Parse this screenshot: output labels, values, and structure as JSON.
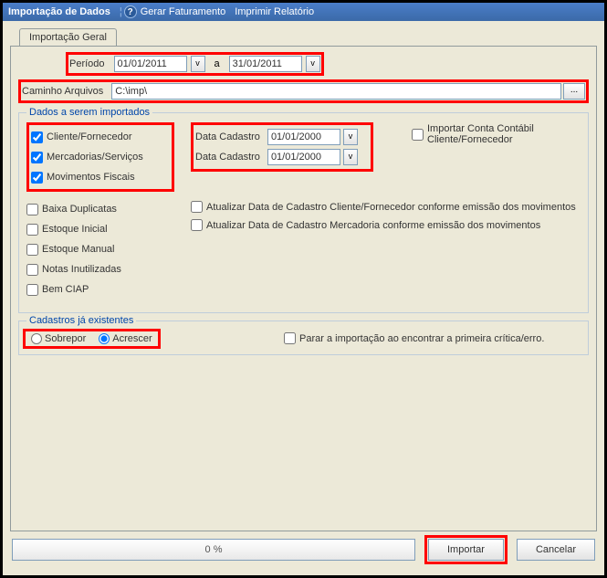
{
  "titlebar": {
    "title": "Importação de Dados",
    "menu_faturamento": "Gerar Faturamento",
    "menu_relatorio": "Imprimir Relatório",
    "help": "?"
  },
  "tab": {
    "label": "Importação Geral"
  },
  "periodo": {
    "label": "Período",
    "a_label": "a",
    "inicio": "01/01/2011",
    "fim": "31/01/2011",
    "v": "v"
  },
  "caminho": {
    "label": "Caminho Arquivos",
    "value": "C:\\imp\\",
    "browse": "..."
  },
  "dados": {
    "legend": "Dados a serem importados",
    "cliente": "Cliente/Fornecedor",
    "mercadorias": "Mercadorias/Serviços",
    "movimentos": "Movimentos Fiscais",
    "data_cad1_label": "Data Cadastro",
    "data_cad1_value": "01/01/2000",
    "data_cad2_label": "Data Cadastro",
    "data_cad2_value": "01/01/2000",
    "importar_conta": "Importar Conta Contábil Cliente/Fornecedor",
    "atualizar1": "Atualizar Data de Cadastro Cliente/Fornecedor conforme emissão dos movimentos",
    "atualizar2": "Atualizar Data de Cadastro Mercadoria conforme emissão dos movimentos",
    "baixa": "Baixa Duplicatas",
    "estoque_inicial": "Estoque Inicial",
    "estoque_manual": "Estoque Manual",
    "notas": "Notas Inutilizadas",
    "bem_ciap": "Bem CIAP"
  },
  "cadastros": {
    "legend": "Cadastros já existentes",
    "sobrepor": "Sobrepor",
    "acrescer": "Acrescer",
    "parar": "Parar a importação ao encontrar a primeira crítica/erro."
  },
  "bottom": {
    "progress": "0 %",
    "importar": "Importar",
    "cancelar": "Cancelar"
  }
}
